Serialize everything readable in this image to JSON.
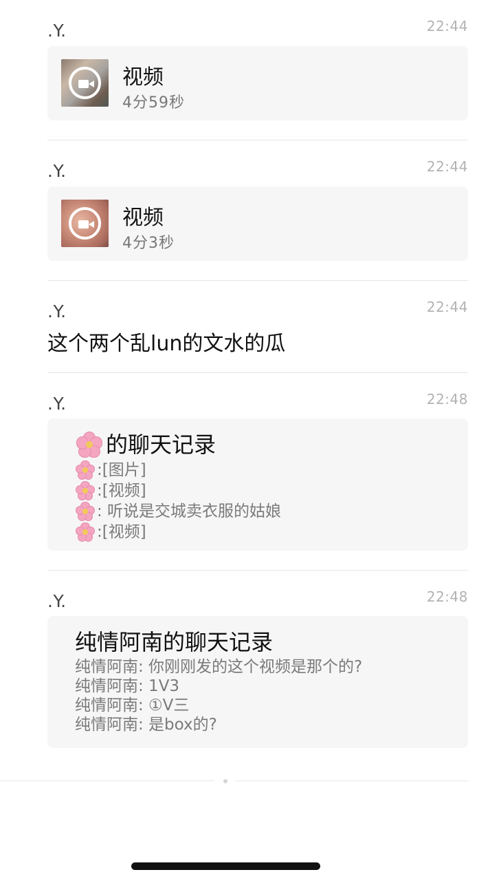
{
  "messages": [
    {
      "sender": ".Y.",
      "time": "22:44",
      "type": "video",
      "title": "视频",
      "duration": "4分59秒"
    },
    {
      "sender": ".Y.",
      "time": "22:44",
      "type": "video",
      "title": "视频",
      "duration": "4分3秒"
    },
    {
      "sender": ".Y.",
      "time": "22:44",
      "type": "text",
      "text": "这个两个乱lun的文水的瓜"
    },
    {
      "sender": ".Y.",
      "time": "22:48",
      "type": "chat_record",
      "title": "的聊天记录",
      "title_icon": "cherry-blossom-emoji",
      "lines": [
        {
          "icon": "cherry-blossom-emoji",
          "text": ":[图片]"
        },
        {
          "icon": "cherry-blossom-emoji",
          "text": ":[视频]"
        },
        {
          "icon": "cherry-blossom-emoji",
          "text": ": 听说是交城卖衣服的姑娘"
        },
        {
          "icon": "cherry-blossom-emoji",
          "text": ":[视频]"
        }
      ]
    },
    {
      "sender": ".Y.",
      "time": "22:48",
      "type": "chat_record",
      "title": "纯情阿南的聊天记录",
      "lines": [
        {
          "text": "纯情阿南: 你刚刚发的这个视频是那个的?"
        },
        {
          "text": "纯情阿南: 1V3"
        },
        {
          "text": "纯情阿南: ①V三"
        },
        {
          "text": "纯情阿南: 是box的?"
        }
      ]
    }
  ],
  "colors": {
    "card_bg": "#f6f6f6",
    "sender": "#444444",
    "time": "#b2b2b2",
    "secondary_text": "#7a7a7a"
  }
}
